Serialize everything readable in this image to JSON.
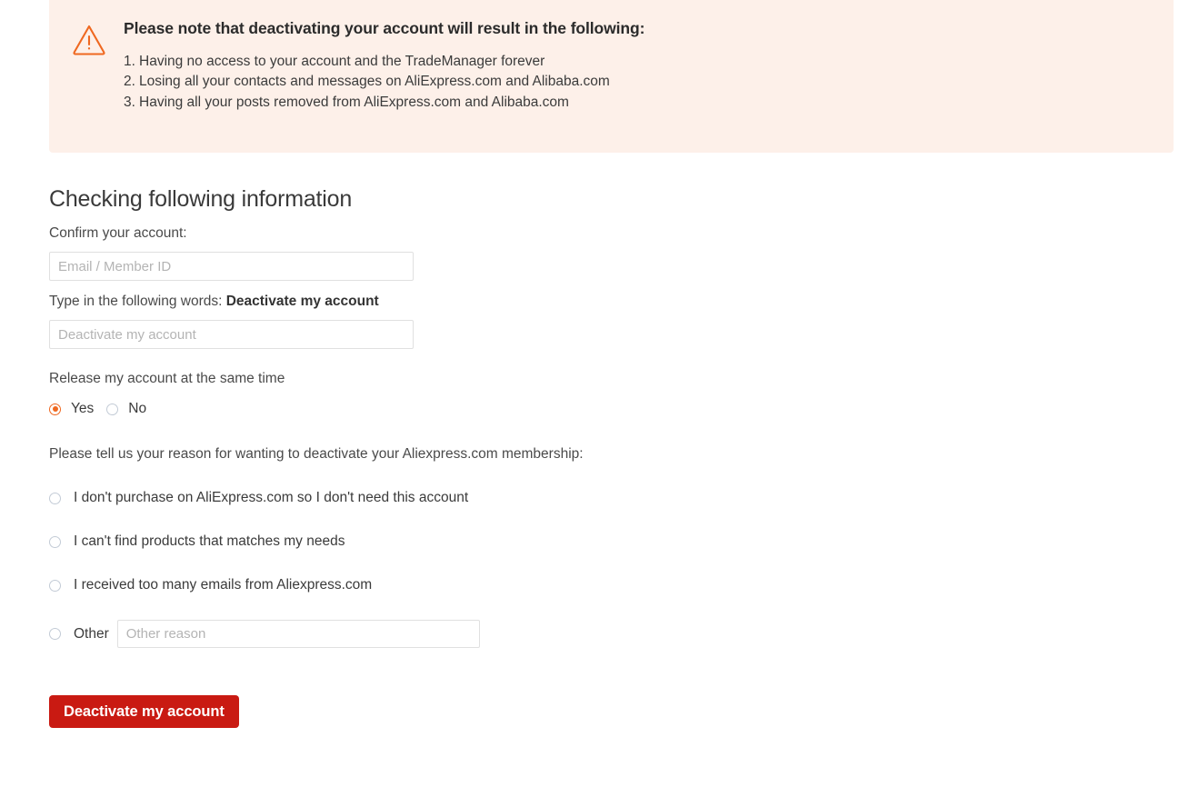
{
  "alert": {
    "icon": "warning-triangle-icon",
    "icon_color": "#ef6820",
    "background_color": "#fdf0e9",
    "title": "Please note that deactivating your account will result in the following:",
    "items": [
      {
        "num": "1.",
        "text": "Having no access to your account and the TradeManager forever"
      },
      {
        "num": "2.",
        "text": "Losing all your contacts and messages on AliExpress.com and Alibaba.com"
      },
      {
        "num": "3.",
        "text": "Having all your posts removed from AliExpress.com and Alibaba.com"
      }
    ]
  },
  "form": {
    "section_title": "Checking following information",
    "confirm_label": "Confirm your account:",
    "confirm_placeholder": "Email / Member ID",
    "confirm_value": "",
    "type_words_prefix": "Type in the following words: ",
    "type_words_phrase": "Deactivate my account",
    "type_words_placeholder": "Deactivate my account",
    "type_words_value": "",
    "release_label": "Release my account at the same time",
    "release_options": [
      {
        "label": "Yes",
        "checked": true
      },
      {
        "label": "No",
        "checked": false
      }
    ],
    "reason_prompt": "Please tell us your reason for wanting to deactivate your Aliexpress.com membership:",
    "reasons": [
      {
        "label": "I don't purchase on AliExpress.com so I don't need this account",
        "checked": false
      },
      {
        "label": "I can't find products that matches my needs",
        "checked": false
      },
      {
        "label": "I received too many emails from Aliexpress.com",
        "checked": false
      }
    ],
    "other": {
      "label": "Other",
      "checked": false,
      "placeholder": "Other reason",
      "value": ""
    },
    "submit_label": "Deactivate my account",
    "submit_color": "#c91a12",
    "accent_color": "#ef6820"
  }
}
